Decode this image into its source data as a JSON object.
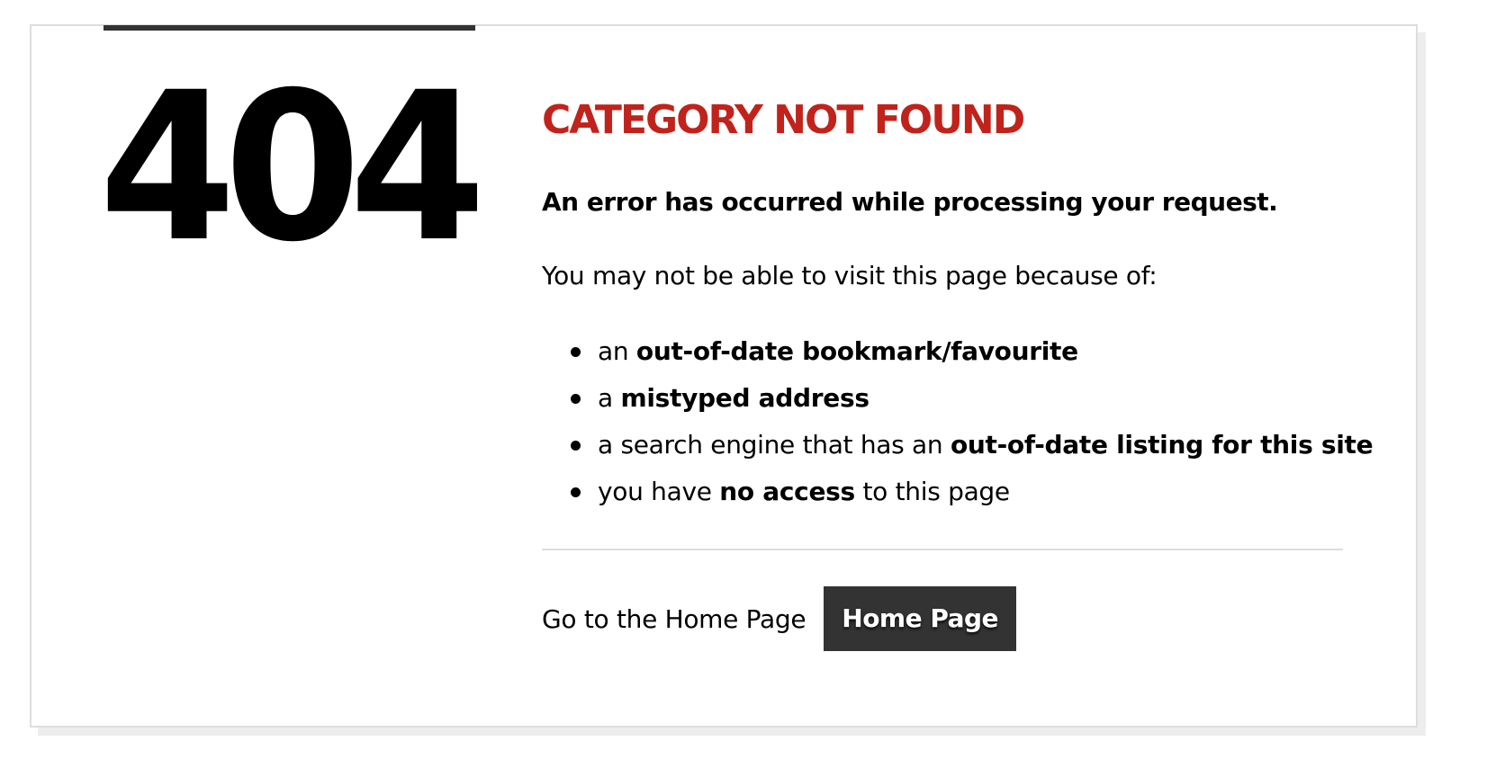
{
  "error": {
    "code": "404",
    "title": "CATEGORY NOT FOUND",
    "message": "An error has occurred while processing your request.",
    "reasons_intro": "You may not be able to visit this page because of:",
    "reasons": [
      {
        "prefix": "an ",
        "bold": "out-of-date bookmark/favourite",
        "suffix": ""
      },
      {
        "prefix": "a ",
        "bold": "mistyped address",
        "suffix": ""
      },
      {
        "prefix": "a search engine that has an ",
        "bold": "out-of-date listing for this site",
        "suffix": ""
      },
      {
        "prefix": "you have ",
        "bold": "no access",
        "suffix": " to this page"
      }
    ]
  },
  "home": {
    "text": "Go to the Home Page",
    "button_label": "Home Page"
  },
  "colors": {
    "title": "#c0231b",
    "button_bg": "#333333",
    "top_bar": "#333333"
  }
}
